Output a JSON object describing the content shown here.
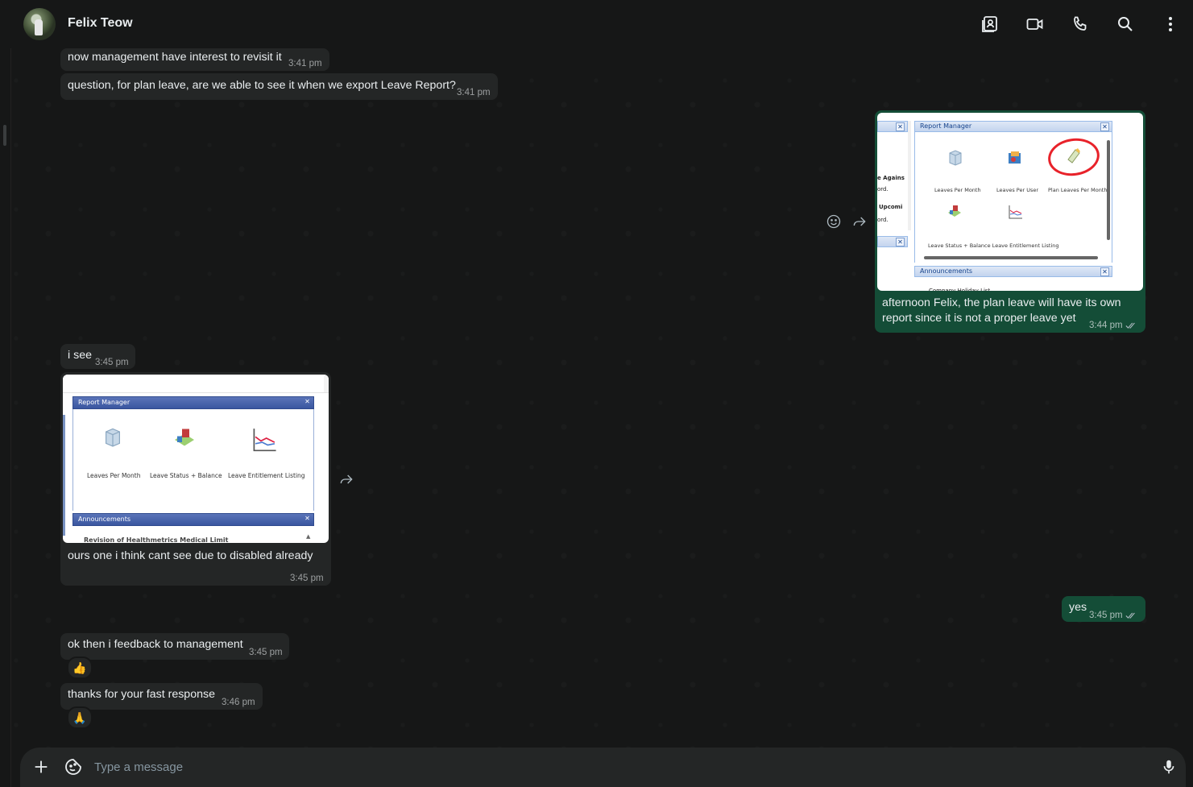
{
  "header": {
    "contact_name": "Felix Teow",
    "icons": [
      "contact-card-icon",
      "video-call-icon",
      "phone-icon",
      "search-icon",
      "menu-dots-icon"
    ]
  },
  "messages": [
    {
      "id": "m1",
      "direction": "in",
      "text": "now management have interest to revisit it",
      "time": "3:41 pm"
    },
    {
      "id": "m2",
      "direction": "in",
      "text": "question, for plan leave, are we able to see it when we export Leave Report?",
      "time": "3:41 pm"
    },
    {
      "id": "m3",
      "direction": "out",
      "type": "image",
      "caption_line1": "afternoon Felix, the plan leave will have its own",
      "caption_line2": "report since it is not a proper leave yet",
      "time": "3:44 pm",
      "image": {
        "panel_title": "Report Manager",
        "items": [
          "Leaves Per Month",
          "Leaves Per User",
          "Plan Leaves Per Month"
        ],
        "row2_label": "Leave Status + Balance Leave Entitlement Listing",
        "side_text": [
          "e Agains",
          "ord.",
          "Upcomi",
          "ord."
        ],
        "bottom_panel": "Announcements",
        "bottom_text": "Company Holiday List"
      }
    },
    {
      "id": "m4",
      "direction": "in",
      "text": "i see",
      "time": "3:45 pm"
    },
    {
      "id": "m5",
      "direction": "in",
      "type": "image",
      "caption": "ours one i think cant see due to disabled already",
      "time": "3:45 pm",
      "image": {
        "panel_title": "Report Manager",
        "items": [
          "Leaves Per Month",
          "Leave Status + Balance",
          "Leave Entitlement Listing"
        ],
        "bottom_panel": "Announcements",
        "bottom_text": "Revision of Healthmetrics Medical Limit"
      }
    },
    {
      "id": "m6",
      "direction": "out",
      "text": "yes",
      "time": "3:45 pm"
    },
    {
      "id": "m7",
      "direction": "in",
      "text": "ok then i feedback to management",
      "time": "3:45 pm",
      "reaction": "👍"
    },
    {
      "id": "m8",
      "direction": "in",
      "text": "thanks for your fast response",
      "time": "3:46 pm",
      "reaction": "🙏"
    }
  ],
  "composer": {
    "placeholder": "Type a message"
  },
  "colors": {
    "background": "#161717",
    "incoming_bubble": "#242626",
    "outgoing_bubble": "#144d37",
    "text": "#e9edef",
    "meta": "#8696a0"
  }
}
